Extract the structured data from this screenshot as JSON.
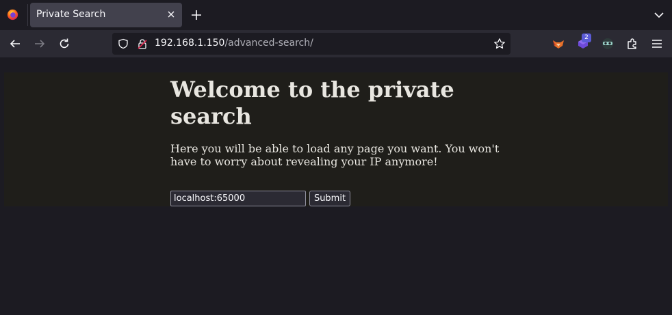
{
  "browser": {
    "tab": {
      "title": "Private Search"
    },
    "address": {
      "host": "192.168.1.150",
      "path": "/advanced-search/"
    },
    "extensions": {
      "badge_count": "2"
    },
    "icons": {
      "app": "firefox-icon",
      "tab_close": "close-icon",
      "new_tab": "plus-icon",
      "tab_list": "chevron-down-icon",
      "back": "back-arrow-icon",
      "forward": "forward-arrow-icon",
      "reload": "reload-icon",
      "shield": "shield-icon",
      "lock": "lock-icon",
      "bookmark": "star-icon",
      "extension1": "fox-extension-icon",
      "extension2": "purple-extension-icon",
      "extension3": "mask-extension-icon",
      "extensions_menu": "puzzle-icon",
      "menu": "hamburger-menu-icon"
    }
  },
  "page": {
    "heading": "Welcome to the private search",
    "description": "Here you will be able to load any page you want. You won't have to worry about revealing your IP anymore!",
    "form": {
      "input_value": "localhost:65000",
      "submit_label": "Submit"
    }
  },
  "colors": {
    "chrome_background": "#1c1b22",
    "toolbar": "#2b2a33",
    "active_tab": "#42414d",
    "content_section": "#1f1e1a",
    "text": "#e8e6e0"
  }
}
